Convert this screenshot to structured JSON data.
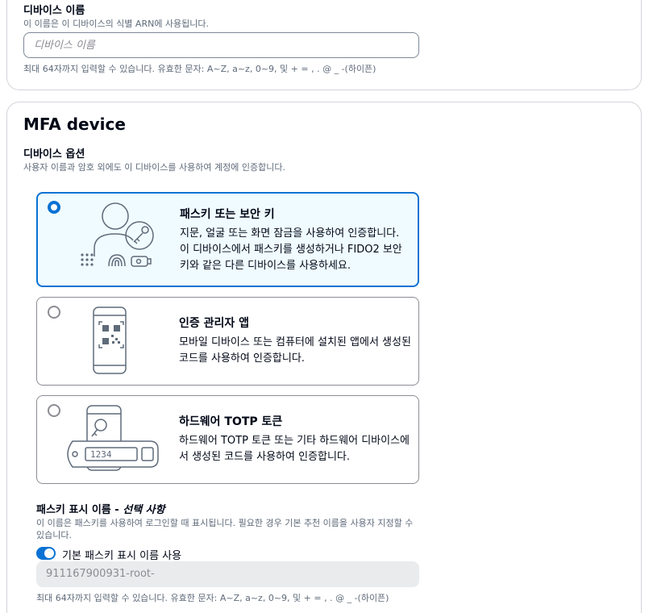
{
  "device_name": {
    "label": "디바이스 이름",
    "description": "이 이름은 이 디바이스의 식별 ARN에 사용됩니다.",
    "placeholder": "디바이스 이름",
    "constraint": "최대 64자까지 입력할 수 있습니다. 유효한 문자: A~Z, a~z, 0~9, 및 + = , . @ _ -(하이픈)"
  },
  "mfa": {
    "title": "MFA device",
    "options_label": "디바이스 옵션",
    "options_description": "사용자 이름과 암호 외에도 이 디바이스를 사용하여 계정에 인증합니다.",
    "options": [
      {
        "title": "패스키 또는 보안 키",
        "description": "지문, 얼굴 또는 화면 잠금을 사용하여 인증합니다. 이 디바이스에서 패스키를 생성하거나 FIDO2 보안 키와 같은 다른 디바이스를 사용하세요.",
        "selected": true,
        "icon": "passkey-illustration"
      },
      {
        "title": "인증 관리자 앱",
        "description": "모바일 디바이스 또는 컴퓨터에 설치된 앱에서 생성된 코드를 사용하여 인증합니다.",
        "selected": false,
        "icon": "authenticator-app-illustration"
      },
      {
        "title": "하드웨어 TOTP 토큰",
        "description": "하드웨어 TOTP 토큰 또는 기타 하드웨어 디바이스에서 생성된 코드를 사용하여 인증합니다.",
        "selected": false,
        "icon": "hardware-token-illustration",
        "token_display": "1234"
      }
    ]
  },
  "passkey_display_name": {
    "label": "패스키 표시 이름 - ",
    "label_optional": "선택 사항",
    "description": "이 이름은 패스키를 사용하여 로그인할 때 표시됩니다. 필요한 경우 기본 추천 이름을 사용자 지정할 수 있습니다.",
    "toggle_label": "기본 패스키 표시 이름 사용",
    "toggle_on": true,
    "value": "911167900931-root-",
    "constraint": "최대 64자까지 입력할 수 있습니다. 유효한 문자: A~Z, a~z, 0~9, 및 + = , . @ _ -(하이픈)"
  },
  "colors": {
    "accent": "#0972d3",
    "selected_bg": "#f0fbff",
    "border": "#8c8c94",
    "muted_text": "#5f6b7a"
  }
}
